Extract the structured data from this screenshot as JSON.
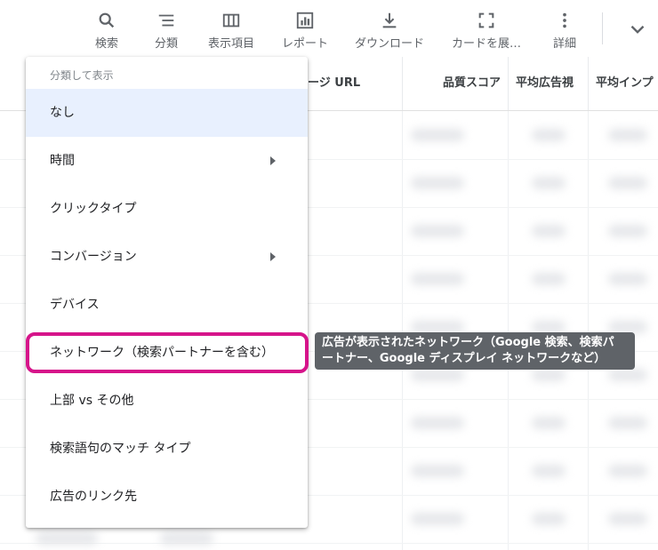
{
  "toolbar": {
    "items": [
      {
        "label": "検索",
        "icon": "search-icon"
      },
      {
        "label": "分類",
        "icon": "segment-icon"
      },
      {
        "label": "表示項目",
        "icon": "columns-icon"
      },
      {
        "label": "レポート",
        "icon": "report-icon"
      },
      {
        "label": "ダウンロード",
        "icon": "download-icon"
      },
      {
        "label": "カードを展…",
        "icon": "expand-icon"
      },
      {
        "label": "詳細",
        "icon": "more-vert-icon"
      }
    ],
    "chevron_icon": "chevron-down-icon"
  },
  "table": {
    "headers": [
      "ページ URL",
      "品質スコア",
      "平均広告視",
      "平均インプ"
    ]
  },
  "menu": {
    "header": "分類して表示",
    "items": [
      {
        "label": "なし",
        "selected": true,
        "has_submenu": false
      },
      {
        "label": "時間",
        "selected": false,
        "has_submenu": true
      },
      {
        "label": "クリックタイプ",
        "selected": false,
        "has_submenu": false
      },
      {
        "label": "コンバージョン",
        "selected": false,
        "has_submenu": true
      },
      {
        "label": "デバイス",
        "selected": false,
        "has_submenu": false
      },
      {
        "label": "ネットワーク（検索パートナーを含む）",
        "selected": false,
        "has_submenu": false,
        "highlighted": true
      },
      {
        "label": "上部 vs その他",
        "selected": false,
        "has_submenu": false
      },
      {
        "label": "検索語句のマッチ タイプ",
        "selected": false,
        "has_submenu": false
      },
      {
        "label": "広告のリンク先",
        "selected": false,
        "has_submenu": false
      }
    ]
  },
  "tooltip": {
    "line1": "広告が表示されたネットワーク（Google 検索、検索パ",
    "line2": "ートナー、Google ディスプレイ ネットワークなど）"
  },
  "colors": {
    "highlight": "#d6148a",
    "tooltip_bg": "#5f6368",
    "selected_bg": "#e8f0fe"
  }
}
